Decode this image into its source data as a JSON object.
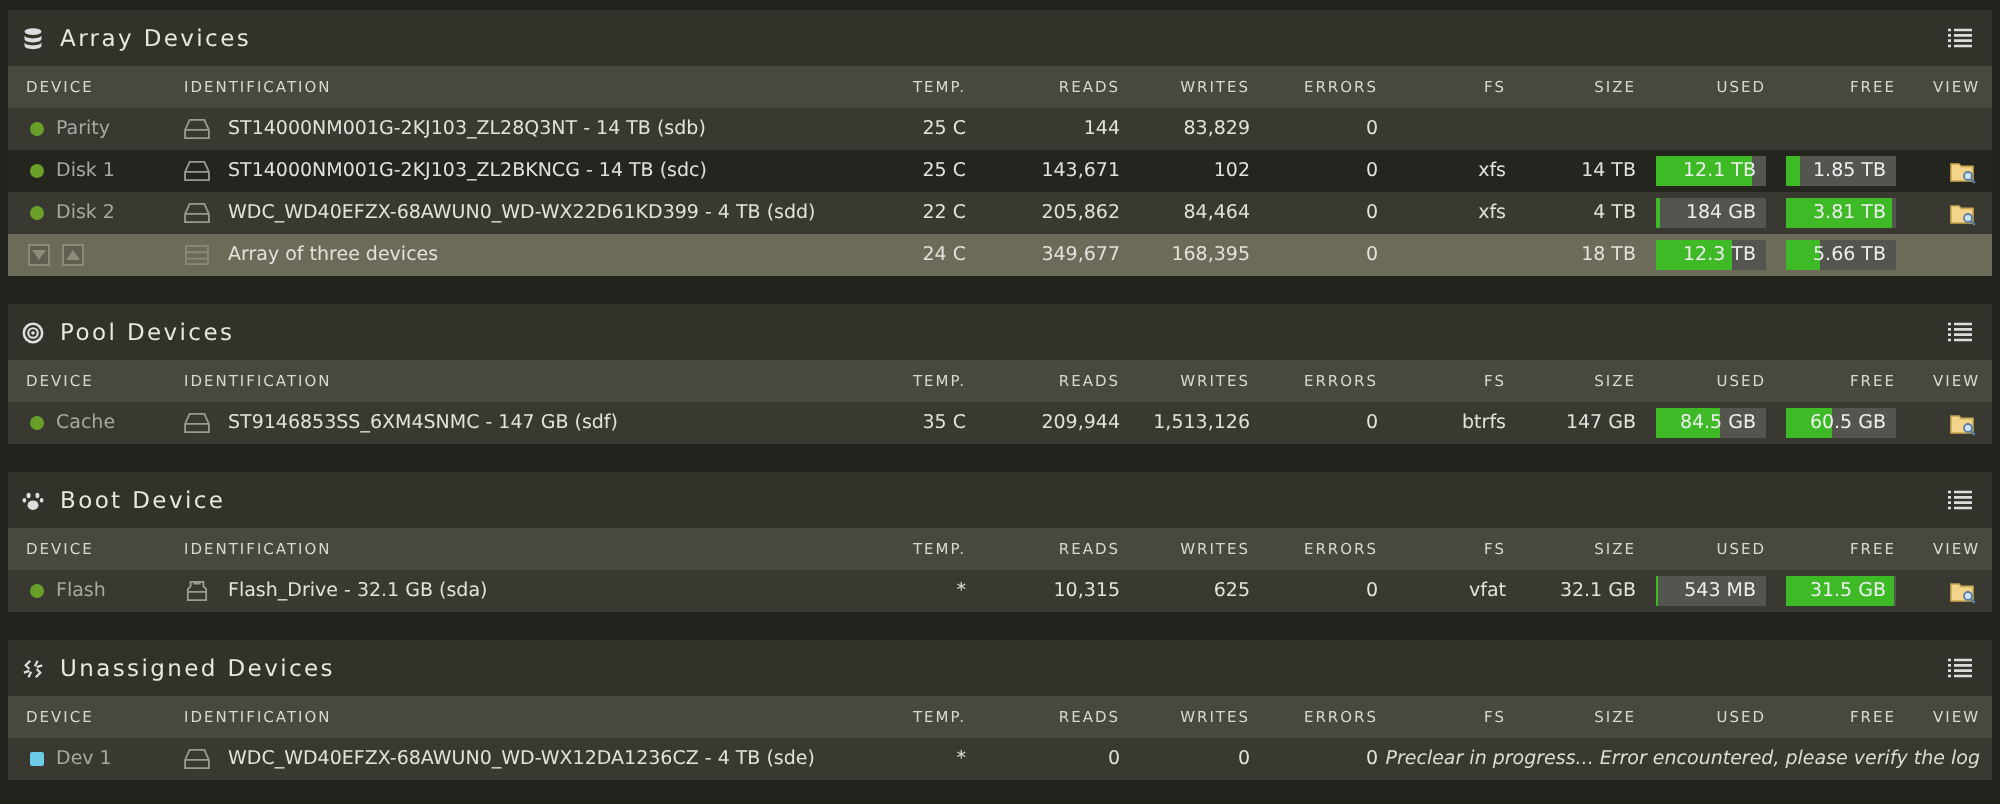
{
  "sections": [
    {
      "kind": "array",
      "title": "Array Devices",
      "columns": [
        "DEVICE",
        "IDENTIFICATION",
        "TEMP.",
        "READS",
        "WRITES",
        "ERRORS",
        "FS",
        "SIZE",
        "USED",
        "FREE",
        "VIEW"
      ],
      "rows": [
        {
          "kind": "disk",
          "device": "Parity",
          "color": "#6a9f2a",
          "identification": "ST14000NM001G-2KJ103_ZL28Q3NT - 14 TB (sdb)",
          "temp": "25 C",
          "reads": "144",
          "writes": "83,829",
          "errors": "0",
          "view": false
        },
        {
          "kind": "disk",
          "device": "Disk 1",
          "color": "#6a9f2a",
          "identification": "ST14000NM001G-2KJ103_ZL2BKNCG - 14 TB (sdc)",
          "temp": "25 C",
          "reads": "143,671",
          "writes": "102",
          "errors": "0",
          "fs": "xfs",
          "size": "14 TB",
          "used": {
            "text": "12.1 TB",
            "level": 0.87
          },
          "free": {
            "text": "1.85 TB",
            "level": 0.13
          },
          "view": true
        },
        {
          "kind": "disk",
          "device": "Disk 2",
          "color": "#6a9f2a",
          "identification": "WDC_WD40EFZX-68AWUN0_WD-WX22D61KD399 - 4 TB (sdd)",
          "temp": "22 C",
          "reads": "205,862",
          "writes": "84,464",
          "errors": "0",
          "fs": "xfs",
          "size": "4 TB",
          "used": {
            "text": "184 GB",
            "level": 0.04
          },
          "free": {
            "text": "3.81 TB",
            "level": 0.96
          },
          "view": true
        },
        {
          "kind": "total",
          "identification": "Array of three devices",
          "temp": "24 C",
          "reads": "349,677",
          "writes": "168,395",
          "errors": "0",
          "size": "18 TB",
          "used": {
            "text": "12.3 TB",
            "level": 0.69
          },
          "free": {
            "text": "5.66 TB",
            "level": 0.31
          }
        }
      ]
    },
    {
      "kind": "pool",
      "title": "Pool Devices",
      "columns": [
        "DEVICE",
        "IDENTIFICATION",
        "TEMP.",
        "READS",
        "WRITES",
        "ERRORS",
        "FS",
        "SIZE",
        "USED",
        "FREE",
        "VIEW"
      ],
      "rows": [
        {
          "kind": "disk",
          "device": "Cache",
          "color": "#6a9f2a",
          "identification": "ST9146853SS_6XM4SNMC - 147 GB (sdf)",
          "temp": "35 C",
          "reads": "209,944",
          "writes": "1,513,126",
          "errors": "0",
          "fs": "btrfs",
          "size": "147 GB",
          "used": {
            "text": "84.5 GB",
            "level": 0.58
          },
          "free": {
            "text": "60.5 GB",
            "level": 0.42
          },
          "view": true
        }
      ]
    },
    {
      "kind": "boot",
      "title": "Boot Device",
      "columns": [
        "DEVICE",
        "IDENTIFICATION",
        "TEMP.",
        "READS",
        "WRITES",
        "ERRORS",
        "FS",
        "SIZE",
        "USED",
        "FREE",
        "VIEW"
      ],
      "rows": [
        {
          "kind": "flash",
          "device": "Flash",
          "color": "#6a9f2a",
          "identification": "Flash_Drive - 32.1 GB (sda)",
          "temp": "*",
          "reads": "10,315",
          "writes": "625",
          "errors": "0",
          "fs": "vfat",
          "size": "32.1 GB",
          "used": {
            "text": "543 MB",
            "level": 0.02
          },
          "free": {
            "text": "31.5 GB",
            "level": 0.98
          },
          "view": true
        }
      ]
    },
    {
      "kind": "unassigned",
      "title": "Unassigned Devices",
      "columns": [
        "DEVICE",
        "IDENTIFICATION",
        "TEMP.",
        "READS",
        "WRITES",
        "ERRORS",
        "FS",
        "SIZE",
        "USED",
        "FREE",
        "VIEW"
      ],
      "rows": [
        {
          "kind": "unassigned",
          "device": "Dev 1",
          "color": "#6ccbe6",
          "identification": "WDC_WD40EFZX-68AWUN0_WD-WX12DA1236CZ - 4 TB (sde)",
          "temp": "*",
          "reads": "0",
          "writes": "0",
          "errors": "0",
          "message": "Preclear in progress... Error encountered, please verify the log"
        }
      ]
    }
  ]
}
